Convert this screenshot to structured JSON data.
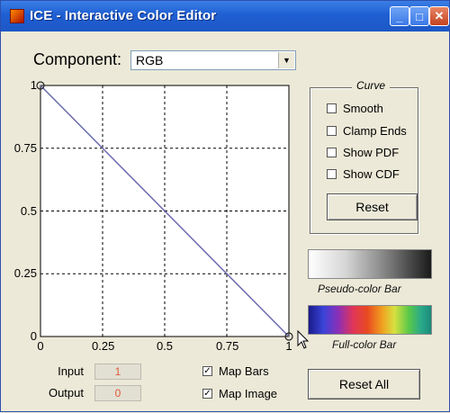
{
  "window": {
    "title": "ICE - Interactive Color Editor",
    "controls": {
      "minimize": "_",
      "maximize": "□",
      "close": "✕"
    }
  },
  "component": {
    "label": "Component:",
    "selected": "RGB",
    "arrow": "▼"
  },
  "plot": {
    "x_ticks": [
      "0",
      "0.25",
      "0.5",
      "0.75",
      "1"
    ],
    "y_ticks": [
      "1",
      "0.75",
      "0.5",
      "0.25",
      "0"
    ],
    "curve_points": [
      [
        0,
        1
      ],
      [
        1,
        0
      ]
    ],
    "line_color": "#6b6bb0",
    "grid": true
  },
  "curve_panel": {
    "legend": "Curve",
    "checkboxes": [
      {
        "label": "Smooth",
        "checked": false
      },
      {
        "label": "Clamp Ends",
        "checked": false
      },
      {
        "label": "Show PDF",
        "checked": false
      },
      {
        "label": "Show CDF",
        "checked": false
      }
    ],
    "reset_label": "Reset"
  },
  "bars": {
    "pseudo_caption": "Pseudo-color Bar",
    "full_caption": "Full-color Bar"
  },
  "io": {
    "input_label": "Input",
    "input_value": "1",
    "output_label": "Output",
    "output_value": "0"
  },
  "map": {
    "map_bars_label": "Map Bars",
    "map_bars_checked": true,
    "map_image_label": "Map Image",
    "map_image_checked": true
  },
  "reset_all_label": "Reset All"
}
